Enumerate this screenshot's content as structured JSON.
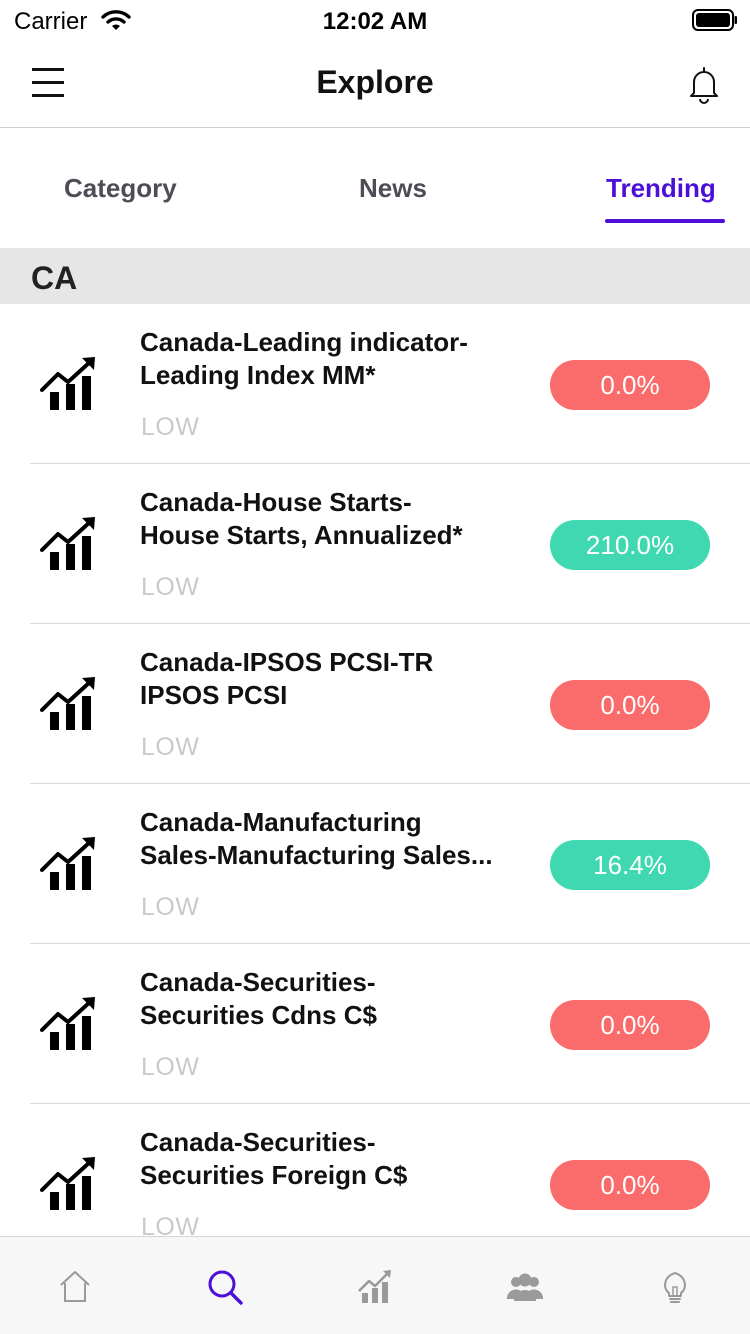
{
  "status_bar": {
    "carrier": "Carrier",
    "time": "12:02 AM"
  },
  "nav": {
    "title": "Explore",
    "menu_icon": "hamburger-menu-icon",
    "bell_icon": "bell-icon"
  },
  "tabs": [
    {
      "label": "Category",
      "active": false
    },
    {
      "label": "News",
      "active": false
    },
    {
      "label": "Trending",
      "active": true
    }
  ],
  "section": {
    "title": "CA"
  },
  "items": [
    {
      "title_line1": "Canada-Leading indicator-",
      "title_line2": "Leading Index MM*",
      "impact": "LOW",
      "change": "0.0%",
      "direction": "neg"
    },
    {
      "title_line1": "Canada-House Starts-",
      "title_line2": "House Starts, Annualized*",
      "impact": "LOW",
      "change": "210.0%",
      "direction": "pos"
    },
    {
      "title_line1": "Canada-IPSOS PCSI-TR",
      "title_line2": "IPSOS PCSI",
      "impact": "LOW",
      "change": "0.0%",
      "direction": "neg"
    },
    {
      "title_line1": "Canada-Manufacturing",
      "title_line2": "Sales-Manufacturing Sales...",
      "impact": "LOW",
      "change": "16.4%",
      "direction": "pos"
    },
    {
      "title_line1": "Canada-Securities-",
      "title_line2": "Securities Cdns C$",
      "impact": "LOW",
      "change": "0.0%",
      "direction": "neg"
    },
    {
      "title_line1": "Canada-Securities-",
      "title_line2": "Securities Foreign C$",
      "impact": "LOW",
      "change": "0.0%",
      "direction": "neg"
    }
  ],
  "tab_bar": [
    {
      "icon": "home-icon",
      "active": false
    },
    {
      "icon": "search-icon",
      "active": true
    },
    {
      "icon": "chart-icon",
      "active": false
    },
    {
      "icon": "people-icon",
      "active": false
    },
    {
      "icon": "lightbulb-icon",
      "active": false
    }
  ],
  "colors": {
    "accent": "#4b0fd8",
    "negative": "#fa6b6b",
    "positive": "#3fd8b0",
    "impact_text": "#c9c9c9",
    "section_bg": "#e6e6e6"
  }
}
